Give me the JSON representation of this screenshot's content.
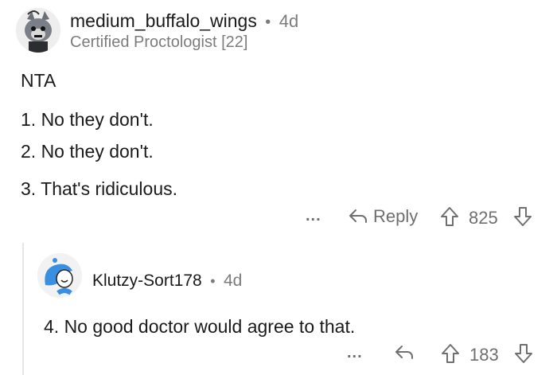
{
  "comment": {
    "username": "medium_buffalo_wings",
    "separator": "•",
    "age": "4d",
    "flair": "Certified Proctologist [22]",
    "lines": [
      "NTA",
      "1. No they don't.",
      "2. No they don't.",
      "3. That's ridiculous."
    ],
    "actions": {
      "more": "...",
      "reply_label": "Reply",
      "score": "825"
    }
  },
  "reply": {
    "username": "Klutzy-Sort178",
    "separator": "•",
    "age": "4d",
    "lines": [
      "4. No good doctor would agree to that."
    ],
    "actions": {
      "more": "...",
      "score": "183"
    }
  },
  "icons": {
    "more": "ellipsis-icon",
    "reply": "reply-arrow-icon",
    "upvote": "upvote-arrow-icon",
    "downvote": "downvote-arrow-icon"
  },
  "colors": {
    "text": "#1a1a1b",
    "meta": "#7c7c7c",
    "action": "#6f6f6f",
    "reply_avatar": "#3b8fe0"
  }
}
